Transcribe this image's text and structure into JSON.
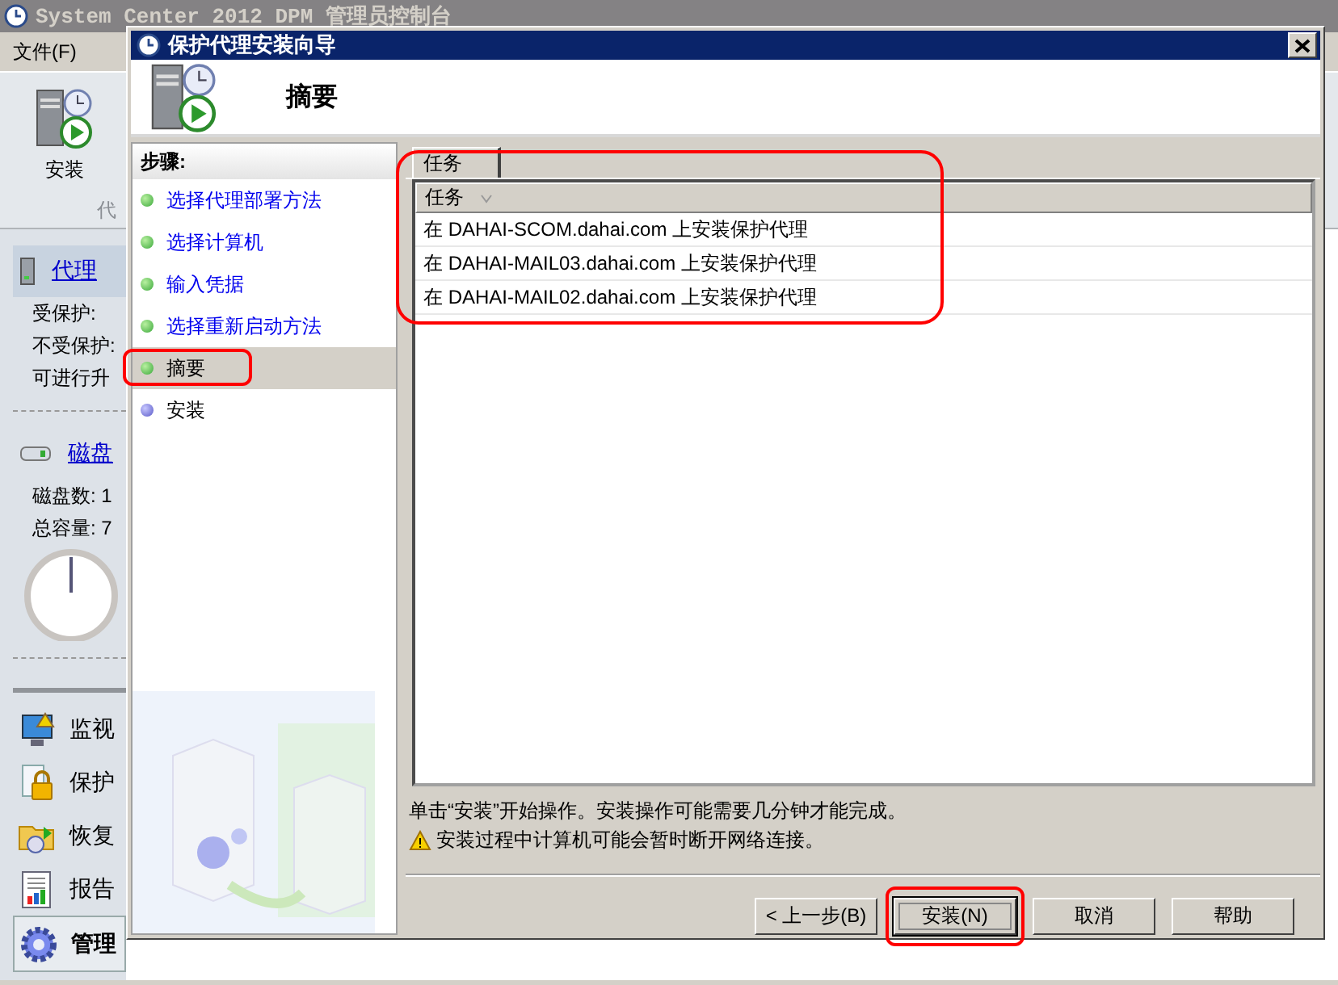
{
  "console": {
    "title": "System Center 2012 DPM 管理员控制台",
    "menu": [
      "文件(F)"
    ],
    "toolbar": [
      {
        "label": "安装"
      }
    ],
    "toolbar_group": "代",
    "sections": [
      {
        "kind": "agents",
        "title": "代理",
        "lines": [
          "受保护:",
          "不受保护:",
          "可进行升"
        ]
      },
      {
        "kind": "disks",
        "title": "磁盘",
        "lines": [
          "磁盘数: 1",
          "总容量: 7"
        ]
      }
    ],
    "nav": [
      {
        "kind": "monitor",
        "label": "监视",
        "selected": false
      },
      {
        "kind": "protect",
        "label": "保护",
        "selected": false
      },
      {
        "kind": "recover",
        "label": "恢复",
        "selected": false
      },
      {
        "kind": "report",
        "label": "报告",
        "selected": false
      },
      {
        "kind": "admin",
        "label": "管理",
        "selected": true
      }
    ]
  },
  "wizard": {
    "title": "保护代理安装向导",
    "heading": "摘要",
    "steps_title": "步骤:",
    "steps": [
      {
        "label": "选择代理部署方法",
        "completed": true,
        "selected": false,
        "highlighted": false
      },
      {
        "label": "选择计算机",
        "completed": true,
        "selected": false,
        "highlighted": false
      },
      {
        "label": "输入凭据",
        "completed": true,
        "selected": false,
        "highlighted": false
      },
      {
        "label": "选择重新启动方法",
        "completed": true,
        "selected": false,
        "highlighted": false
      },
      {
        "label": "摘要",
        "completed": true,
        "selected": true,
        "highlighted": true
      },
      {
        "label": "安装",
        "completed": false,
        "selected": false,
        "highlighted": false
      }
    ],
    "tab": "任务",
    "tasks": {
      "highlighted": true,
      "columns": [
        "任务"
      ],
      "rows": [
        "在 DAHAI-SCOM.dahai.com 上安装保护代理",
        "在 DAHAI-MAIL03.dahai.com 上安装保护代理",
        "在 DAHAI-MAIL02.dahai.com 上安装保护代理"
      ]
    },
    "info": "单击“安装”开始操作。安装操作可能需要几分钟才能完成。",
    "warning": "安装过程中计算机可能会暂时断开网络连接。",
    "buttons": [
      {
        "label": "< 上一步(B)",
        "default": false,
        "highlighted": false
      },
      {
        "label": "安装(N)",
        "default": true,
        "highlighted": true
      },
      {
        "label": "取消",
        "default": false,
        "highlighted": false
      },
      {
        "label": "帮助",
        "default": false,
        "highlighted": false
      }
    ]
  }
}
